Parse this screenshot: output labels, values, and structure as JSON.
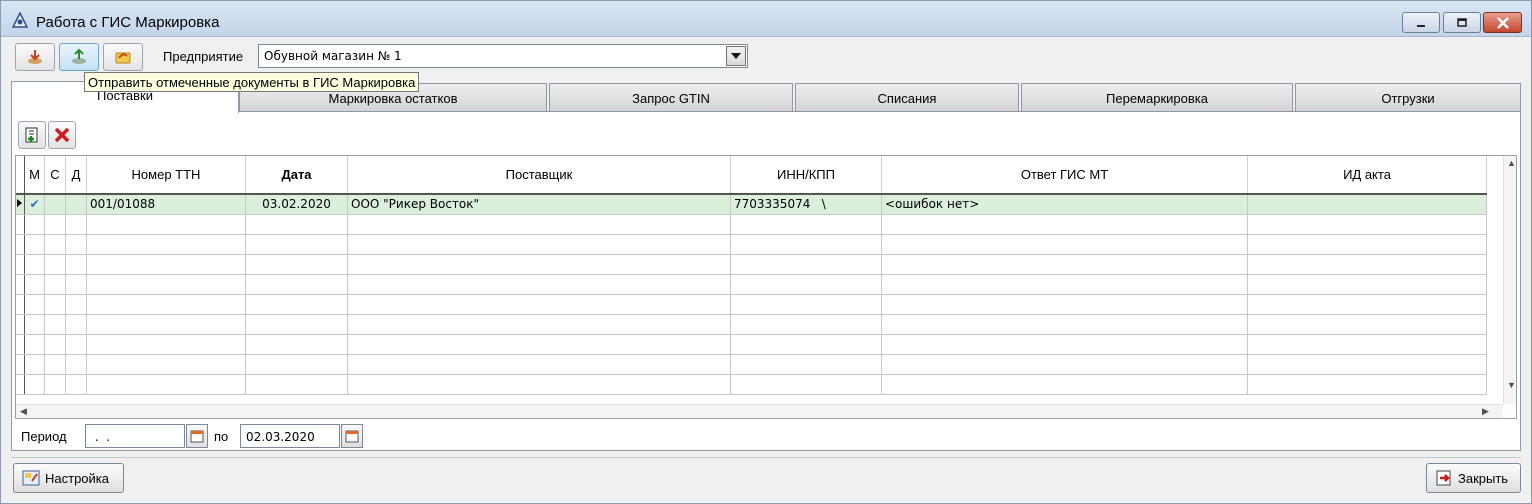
{
  "window": {
    "title": "Работа с ГИС Маркировка"
  },
  "toolbar": {
    "enterprise_label": "Предприятие",
    "enterprise_value": "Обувной магазин № 1",
    "tooltip": "Отправить отмеченные документы в ГИС Маркировка"
  },
  "tabs": [
    {
      "label": "Поставки",
      "active": true
    },
    {
      "label": "Маркировка остатков"
    },
    {
      "label": "Запрос GTIN"
    },
    {
      "label": "Списания"
    },
    {
      "label": "Перемаркировка"
    },
    {
      "label": "Отгрузки"
    }
  ],
  "grid": {
    "columns": [
      "М",
      "С",
      "Д",
      "Номер ТТН",
      "Дата",
      "Поставщик",
      "ИНН/КПП",
      "Ответ ГИС МТ",
      "ИД акта"
    ],
    "rows": [
      {
        "m": "✔",
        "c": "",
        "d": "",
        "ttn": "001/01088",
        "date": "03.02.2020",
        "supplier": "ООО \"Рикер Восток\"",
        "inn": "7703335074   \\",
        "answer": "<ошибок нет>",
        "act_id": ""
      }
    ]
  },
  "period": {
    "label": "Период",
    "from": " .  .",
    "to_label": "по",
    "to": "02.03.2020"
  },
  "footer": {
    "settings_label": "Настройка",
    "close_label": "Закрыть"
  },
  "colors": {
    "selected_row": "#dcefdc",
    "close_button": "#c4462f"
  }
}
